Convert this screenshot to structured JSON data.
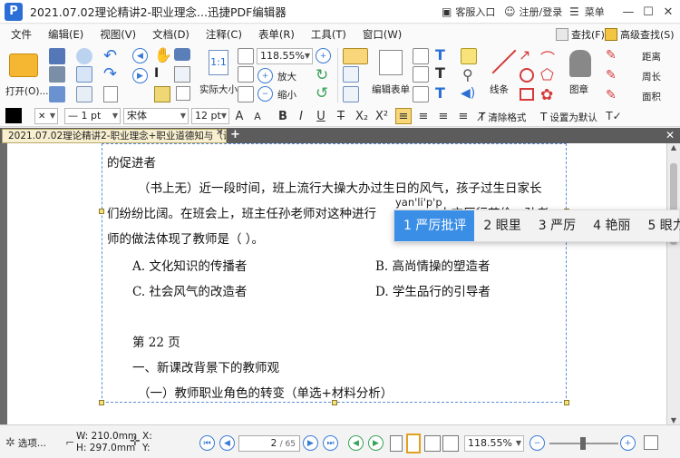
{
  "window": {
    "title": "2021.07.02理论精讲2-职业理念...迅捷PDF编辑器",
    "customer_service": "客服入口",
    "login": "注册/登录",
    "menu": "菜单"
  },
  "menubar": {
    "items": [
      "文件",
      "编辑(E)",
      "视图(V)",
      "文档(D)",
      "注释(C)",
      "表单(R)",
      "工具(T)",
      "窗口(W)"
    ],
    "find": "查找(F)",
    "advanced_find": "高级查找(S)"
  },
  "ribbon": {
    "open_label": "打开(O)...",
    "zoom_value": "118.55%",
    "actual_size": "实际大小",
    "zoom_in": "放大",
    "zoom_out": "缩小",
    "edit_form": "编辑表单",
    "line_shape": "线条",
    "stamp": "图章",
    "distance": "距离",
    "perimeter": "周长",
    "area": "面积"
  },
  "formatbar": {
    "line_width": "1 pt",
    "font_name": "宋体",
    "font_size": "12 pt",
    "clear_format": "清除格式",
    "set_default": "设置为默认"
  },
  "tabs": {
    "doc_tab": "2021.07.02理论精讲2-职业理念+职业道德知与（讲..."
  },
  "document": {
    "lines": [
      "的促进者",
      "（书上无）近一段时间，班上流行大操大办过生日的风气，孩子过生日家长",
      "们纷纷比阔。在班会上，班主任孙老师对这种进行",
      "师的做法体现了教师是（    ）。"
    ],
    "partial_hidden_tail": "大方厉行节俭，孙老",
    "options": {
      "a": "A. 文化知识的传播者",
      "b": "B. 高尚情操的塑造者",
      "c": "C. 社会风气的改造者",
      "d": "D. 学生品行的引导者"
    },
    "page_label": "第 22 页",
    "section1": "一、新课改背景下的教师观",
    "section2": "（一）教师职业角色的转变（单选+材料分析）"
  },
  "ime": {
    "pinyin": "yan'li'p'p",
    "candidates": [
      "1 严厉批评",
      "2 眼里",
      "3 严厉",
      "4 艳丽",
      "5 眼力"
    ],
    "selected_index": 0
  },
  "statusbar": {
    "options": "选项...",
    "width": "W: 210.0mm",
    "height": "H: 297.0mm",
    "x": "X:",
    "y": "Y:",
    "page_current": "2",
    "page_total": "/ 65",
    "zoom": "118.55%"
  }
}
